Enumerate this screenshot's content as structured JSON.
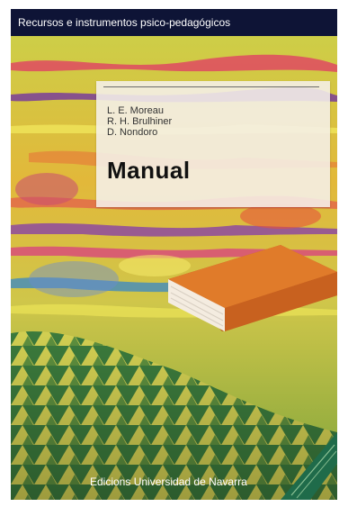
{
  "cover": {
    "series_title": "Recursos e instrumentos psico-pedagógicos",
    "subtitle": "",
    "authors": [
      "L. E. Moreau",
      "R. H. Brulhiner",
      "D. Nondoro"
    ],
    "title": "Manual",
    "publisher": "Edicions Universidad de Navarra"
  },
  "colors": {
    "series_bar": "#0e1436",
    "book_orange": "#e07b2a",
    "background_yellow": "#d9b43a"
  }
}
